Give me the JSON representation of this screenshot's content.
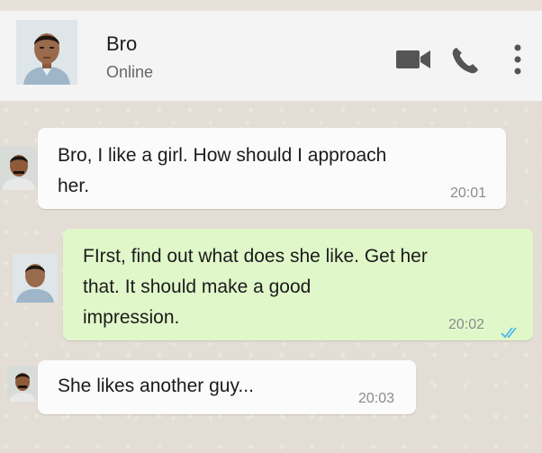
{
  "header": {
    "contact_name": "Bro",
    "contact_status": "Online",
    "icons": [
      "video-call-icon",
      "phone-icon",
      "more-options-icon"
    ]
  },
  "messages": [
    {
      "direction": "incoming",
      "lines": [
        "Bro, I like a girl. How should I approach",
        "her."
      ],
      "time": "20:01"
    },
    {
      "direction": "outgoing",
      "lines": [
        "FIrst, find out what does she like. Get her",
        "that. It should make a good",
        "impression."
      ],
      "time": "20:02",
      "status": "read-double-tick-icon"
    },
    {
      "direction": "incoming",
      "lines": [
        "She likes another guy..."
      ],
      "time": "20:03"
    }
  ],
  "colors": {
    "header_bg": "#f4f4f4",
    "chat_bg": "#e3ddd5",
    "incoming_bubble": "#fbfbfb",
    "outgoing_bubble": "#e0f8c9",
    "icon": "#555555",
    "read_tick": "#4fb6ec"
  }
}
